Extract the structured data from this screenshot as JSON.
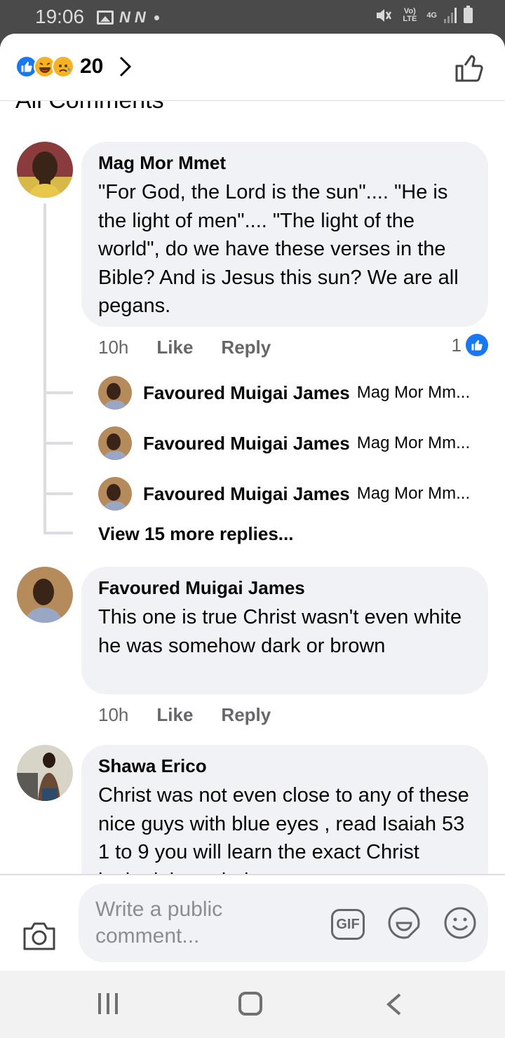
{
  "status_bar": {
    "time": "19:06",
    "network": "Vo) LTE",
    "signal_type": "4G"
  },
  "reactions_bar": {
    "count": "20",
    "icons": [
      "like-icon",
      "haha-icon",
      "sad-icon"
    ],
    "colors": {
      "like": "#1877f2",
      "emoji": "#f7b125"
    }
  },
  "section_header": "All Comments",
  "comments": [
    {
      "author": "Mag Mor Mmet",
      "text": "\"For God, the Lord is the sun\".... \"He is the light of men\".... \"The light of the world\", do we have these verses in the Bible? And is Jesus this sun? We are all pegans.",
      "time": "10h",
      "like_label": "Like",
      "reply_label": "Reply",
      "reaction_count": "1",
      "replies": [
        {
          "author": "Favoured Muigai James",
          "snippet": "Mag Mor Mm..."
        },
        {
          "author": "Favoured Muigai James",
          "snippet": "Mag Mor Mm..."
        },
        {
          "author": "Favoured Muigai James",
          "snippet": "Mag Mor Mm..."
        }
      ],
      "more_replies": "View 15 more replies..."
    },
    {
      "author": "Favoured Muigai James",
      "text": "This one is true Christ wasn't even white he was somehow dark or brown",
      "time": "10h",
      "like_label": "Like",
      "reply_label": "Reply"
    },
    {
      "author": "Shawa Erico",
      "text": "Christ was not even close to any of these nice guys with blue eyes , read Isaiah  53 1 to 9  you will learn the exact Christ looked through the"
    }
  ],
  "composer": {
    "placeholder": "Write a public comment...",
    "gif_label": "GIF"
  }
}
